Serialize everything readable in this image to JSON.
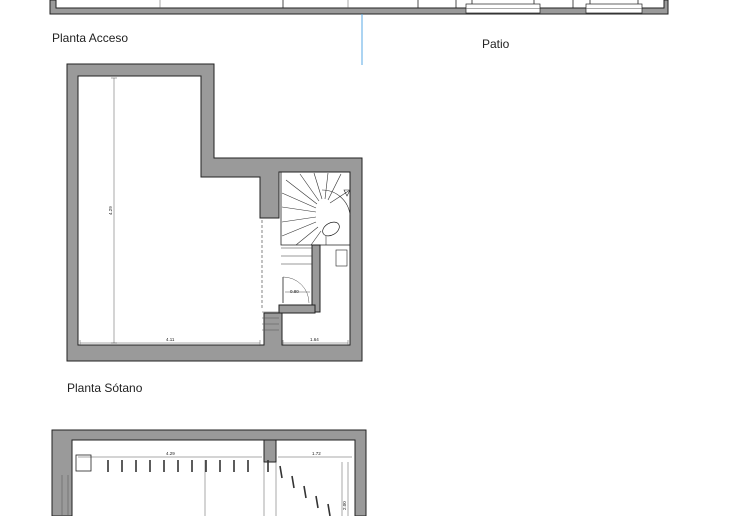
{
  "labels": {
    "planta_acceso": "Planta Acceso",
    "patio": "Patio",
    "planta_sotano": "Planta Sótano"
  },
  "dimensions": {
    "sotano_height": "4.29",
    "sotano_width_main": "4.11",
    "sotano_width_stair": "1.64",
    "door_width": "0.80",
    "lower_width_main": "4.29",
    "lower_width_right": "1.72",
    "lower_height_right": "2.00"
  },
  "colors": {
    "wall_fill": "#9a9a9a",
    "line": "#222222",
    "accent_line": "#5aa9e6"
  }
}
